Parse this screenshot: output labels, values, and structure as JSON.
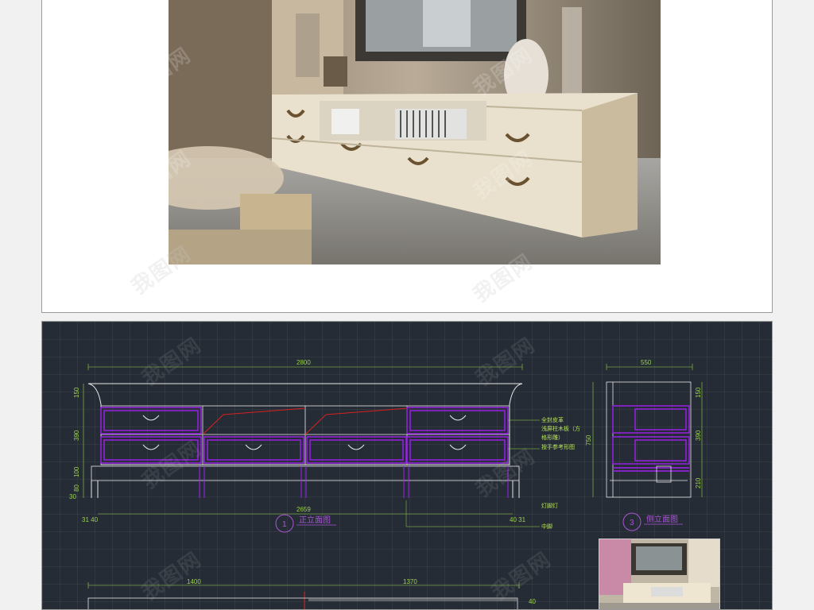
{
  "photo": {
    "subject": "tv-cabinet-photo"
  },
  "front_view": {
    "total_width": "2800",
    "inner_width": "2659",
    "height_top": "150",
    "height_drawer": "390",
    "height_base1": "100",
    "height_base2": "80",
    "height_foot": "30",
    "left_offsets": "31 40",
    "right_offsets": "40 31",
    "title_number": "1",
    "title": "正立面图"
  },
  "side_view": {
    "width": "550",
    "total_height": "750",
    "height_top": "150",
    "height_drawer": "390",
    "height_base": "210",
    "title_number": "3",
    "title": "侧立面图"
  },
  "annotations": {
    "note1": "全封皮革",
    "note2": "浅屏柱木板（方",
    "note3": "格形雕）",
    "note4": "按手参考形图",
    "note5": "灯脚灯",
    "note6": "中脚"
  },
  "plan_view": {
    "left_width": "1400",
    "right_width": "1370",
    "depth": "40"
  },
  "watermark": "我图网",
  "colors": {
    "cad_background": "#252c35",
    "dimension": "#9ad24a",
    "drawer": "#a020f0",
    "outline": "#e8e8e8",
    "red_line": "#d82020"
  }
}
